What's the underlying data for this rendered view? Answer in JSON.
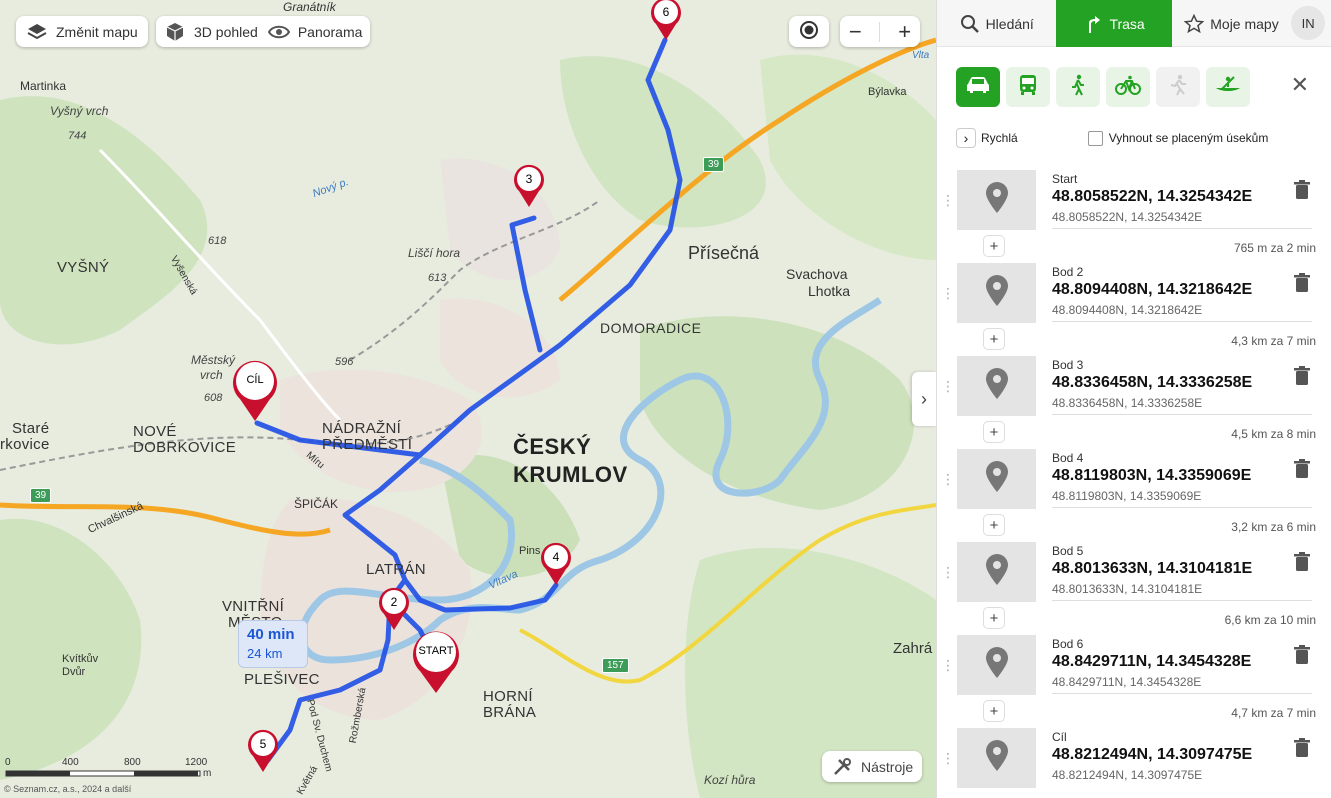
{
  "map": {
    "controls": {
      "change_map": "Změnit mapu",
      "view_3d": "3D pohled",
      "panorama": "Panorama",
      "tools": "Nástroje"
    },
    "labels": {
      "granatnik": "Granátník",
      "martinka": "Martinka",
      "vysny_vrch": "Vyšný vrch",
      "h744": "744",
      "bylavka": "Býlavka",
      "novy_p": "Nový p.",
      "h618": "618",
      "vysny": "VYŠNÝ",
      "lisci_hora": "Liščí hora",
      "h613": "613",
      "prisecna": "Přísečná",
      "svachova": "Svachova",
      "lhotka": "Lhotka",
      "domoradice": "DOMORADICE",
      "h596": "596",
      "mestsky_vrch": "Městský",
      "vrch": "vrch",
      "h608": "608",
      "stare": "Staré",
      "dobrkovice": "rkovice",
      "nove": "NOVÉ",
      "nove_dobrkovice": "DOBRKOVICE",
      "nadrazni": "NÁDRAŽNÍ",
      "predmesti": "PŘEDMĚSTÍ",
      "cesky": "ČESKÝ",
      "krumlov": "KRUMLOV",
      "spicak": "ŠPIČÁK",
      "latran": "LATRÁN",
      "pins": "Pins",
      "vltava": "Vltava",
      "vnitrni": "VNITŘNÍ",
      "mesto": "MĚSTO",
      "kvitkuv": "Kvítkův",
      "dvur": "Dvůr",
      "plesivec": "PLEŠIVEC",
      "horni": "HORNÍ",
      "brana": "BRÁNA",
      "zahrad": "Zahrá",
      "kozi_hura": "Kozí hůra",
      "chvalsinska": "Chvalšinská",
      "vysenska": "Vyšenská",
      "rozmberska": "Rožmberská",
      "pod_sv_duchem": "Pod Sv. Duchem",
      "kvetna": "Květná",
      "miru": "Míru",
      "vlta": "Vlta"
    },
    "roads": {
      "r39a": "39",
      "r39b": "39",
      "r157": "157"
    },
    "pins": {
      "start": "START",
      "cil": "CÍL",
      "p2": "2",
      "p3": "3",
      "p4": "4",
      "p5": "5",
      "p6": "6"
    },
    "route_summary": {
      "time": "40 min",
      "distance": "24 km"
    },
    "scale": {
      "s0": "0",
      "s400": "400",
      "s800": "800",
      "s1200": "1200",
      "unit": "m"
    },
    "copyright": "© Seznam.cz, a.s., 2024 a další"
  },
  "sidebar": {
    "tabs": {
      "search": "Hledání",
      "route": "Trasa",
      "my_maps": "Moje mapy"
    },
    "avatar": "IN",
    "options": {
      "route_type": "Rychlá",
      "avoid_tolls": "Vyhnout se placeným úsekům"
    },
    "waypoints": [
      {
        "label": "Start",
        "coords": "48.8058522N, 14.3254342E",
        "sub": "48.8058522N, 14.3254342E",
        "segment": "765 m za 2 min"
      },
      {
        "label": "Bod 2",
        "coords": "48.8094408N, 14.3218642E",
        "sub": "48.8094408N, 14.3218642E",
        "segment": "4,3 km za 7 min"
      },
      {
        "label": "Bod 3",
        "coords": "48.8336458N, 14.3336258E",
        "sub": "48.8336458N, 14.3336258E",
        "segment": "4,5 km za 8 min"
      },
      {
        "label": "Bod 4",
        "coords": "48.8119803N, 14.3359069E",
        "sub": "48.8119803N, 14.3359069E",
        "segment": "3,2 km za 6 min"
      },
      {
        "label": "Bod 5",
        "coords": "48.8013633N, 14.3104181E",
        "sub": "48.8013633N, 14.3104181E",
        "segment": "6,6 km za 10 min"
      },
      {
        "label": "Bod 6",
        "coords": "48.8429711N, 14.3454328E",
        "sub": "48.8429711N, 14.3454328E",
        "segment": "4,7 km za 7 min"
      },
      {
        "label": "Cíl",
        "coords": "48.8212494N, 14.3097475E",
        "sub": "48.8212494N, 14.3097475E",
        "segment": ""
      }
    ]
  },
  "colors": {
    "accent": "#24a224",
    "route": "#1f4fe6",
    "pin": "#c8102e"
  }
}
